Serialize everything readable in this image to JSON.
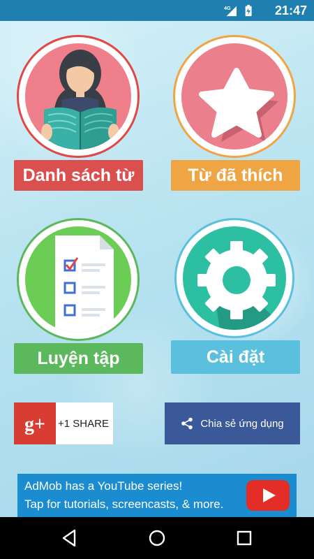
{
  "status_bar": {
    "time": "21:47",
    "network_label": "4G"
  },
  "tiles": [
    {
      "label": "Danh sách từ",
      "icon": "reading-woman-icon",
      "ring_color": "#e04848",
      "fill_color": "#ef7f8a",
      "button_color": "#d9504f"
    },
    {
      "label": "Từ đã thích",
      "icon": "star-icon",
      "ring_color": "#f0a545",
      "fill_color": "#eb7f8b",
      "button_color": "#f0a545"
    },
    {
      "label": "Luyện tập",
      "icon": "checklist-icon",
      "ring_color": "#5cb85c",
      "fill_color": "#6ccd56",
      "button_color": "#5cb85c"
    },
    {
      "label": "Cài đặt",
      "icon": "gear-icon",
      "ring_color": "#5bc0de",
      "fill_color": "#2cbfa2",
      "button_color": "#5bc0de"
    }
  ],
  "google_plus": {
    "label": "+1 SHARE",
    "logo_text": "g+"
  },
  "share_app": {
    "label": "Chia sẻ ứng dụng"
  },
  "ad_banner": {
    "line1": "AdMob has a YouTube series!",
    "line2": "Tap for tutorials, screencasts, & more."
  },
  "nav_bar": {
    "back": "back-icon",
    "home": "home-icon",
    "recents": "recents-icon"
  }
}
